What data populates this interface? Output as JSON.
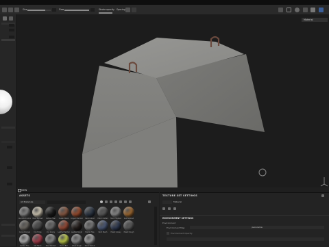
{
  "toolbar": {
    "size_label": "Size",
    "flow_label": "Flow",
    "stroke_opacity_label": "Stroke opacity",
    "spacing_label": "Spacing",
    "size_value": 0.75,
    "flow_value": 1.0,
    "opacity_value": 1.0,
    "spacing_value": 0.1
  },
  "viewport_header": {
    "material_mode": "Material"
  },
  "assets": {
    "title": "ASSETS",
    "filter_label": "All Materials",
    "materials": [
      {
        "name": "Aluminium Amorphous",
        "color": "#8a8a8a"
      },
      {
        "name": "Bone Stylized",
        "color": "#d8cfba"
      },
      {
        "name": "Carbon Fiber",
        "color": "#1a1a1a"
      },
      {
        "name": "Coated Metal",
        "color": "#8b5a43"
      },
      {
        "name": "Copper Hammered",
        "color": "#9b4b2c"
      },
      {
        "name": "Denim Rivet",
        "color": "#2b3544"
      },
      {
        "name": "Fabric Knitted",
        "color": "#5a5a5a"
      },
      {
        "name": "Fabric Stylized",
        "color": "#8d8d8d"
      },
      {
        "name": "Gold Stylized",
        "color": "#a26a31"
      },
      {
        "name": "Ground Gravel",
        "color": "#6e6a64"
      },
      {
        "name": "Iron Forge",
        "color": "#4a4a4a"
      },
      {
        "name": "Iron Grainy",
        "color": "#6f6f6f"
      },
      {
        "name": "Leather Padded",
        "color": "#9a4a35"
      },
      {
        "name": "Leather Rough",
        "color": "#241d1a"
      },
      {
        "name": "Marble Tiles",
        "color": "#7c7c7c"
      },
      {
        "name": "Paint Bluish",
        "color": "#4a5877"
      },
      {
        "name": "Plastic Glossy",
        "color": "#2f3a52"
      },
      {
        "name": "Plastic Rough",
        "color": "#5a5a5a"
      },
      {
        "name": "Rubber Fine",
        "color": "#b3b3b3"
      },
      {
        "name": "Silk Fabric",
        "color": "#a63a48"
      },
      {
        "name": "Steel Painted",
        "color": "#8b8b8b"
      },
      {
        "name": "Tennis Ball",
        "color": "#c4d14a"
      },
      {
        "name": "Wood Rough",
        "color": "#8d8d8d"
      },
      {
        "name": "Wood Walnut",
        "color": "#a3a3a3"
      }
    ]
  },
  "texture_set": {
    "title": "TEXTURE SET SETTINGS",
    "material_tab": "Material",
    "env_header": "ENVIRONMENT SETTINGS",
    "env_mode": "Environment",
    "env_map_label": "Environment Map",
    "env_map_value": "panorama",
    "env_opacity_label": "Environment Opacity"
  },
  "view_tab": "VIEW",
  "colors": {
    "accent": "#4b8df8",
    "concrete_top": "#8f8f8c",
    "concrete_front": "#7f7f7c",
    "concrete_side": "#6e6e6b"
  }
}
